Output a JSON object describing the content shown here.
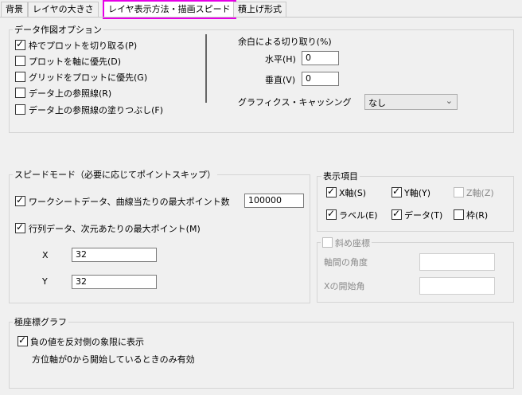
{
  "tabs": [
    "背景",
    "レイヤの大きさ",
    "レイヤ表示方法・描画スピード",
    "積上げ形式"
  ],
  "data_plot_options": {
    "title": "データ作図オプション",
    "items": [
      {
        "label": "枠でプロットを切り取る(P)",
        "checked": true
      },
      {
        "label": "プロットを軸に優先(D)",
        "checked": false
      },
      {
        "label": "グリッドをプロットに優先(G)",
        "checked": false
      },
      {
        "label": "データ上の参照線(R)",
        "checked": false
      },
      {
        "label": "データ上の参照線の塗りつぶし(F)",
        "checked": false
      }
    ],
    "clip_margin_title": "余白による切り取り(%)",
    "horizontal_label": "水平(H)",
    "horizontal_value": "0",
    "vertical_label": "垂直(V)",
    "vertical_value": "0",
    "graphics_caching_label": "グラフィクス・キャッシング",
    "graphics_caching_value": "なし"
  },
  "speed_mode": {
    "title": "スピードモード（必要に応じてポイントスキップ）",
    "worksheet_label": "ワークシートデータ、曲線当たりの最大ポイント数",
    "worksheet_checked": true,
    "worksheet_value": "100000",
    "matrix_label": "行列データ、次元あたりの最大ポイント(M)",
    "matrix_checked": true,
    "x_label": "X",
    "x_value": "32",
    "y_label": "Y",
    "y_value": "32"
  },
  "display_items": {
    "title": "表示項目",
    "items": [
      {
        "label": "X軸(S)",
        "checked": true,
        "disabled": false
      },
      {
        "label": "Y軸(Y)",
        "checked": true,
        "disabled": false
      },
      {
        "label": "Z軸(Z)",
        "checked": false,
        "disabled": true
      },
      {
        "label": "ラベル(E)",
        "checked": true,
        "disabled": false
      },
      {
        "label": "データ(T)",
        "checked": true,
        "disabled": false
      },
      {
        "label": "枠(R)",
        "checked": false,
        "disabled": false
      }
    ]
  },
  "oblique": {
    "title": "斜め座標",
    "checked": false,
    "angle_label": "軸間の角度",
    "angle_value": "",
    "x_start_label": "Xの開始角",
    "x_start_value": ""
  },
  "polar": {
    "title": "極座標グラフ",
    "reverse_label": "負の値を反対側の象限に表示",
    "reverse_checked": true,
    "note": "方位軸が0から開始しているときのみ有効"
  }
}
